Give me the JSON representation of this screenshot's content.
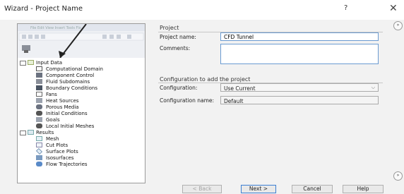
{
  "window": {
    "title": "Wizard - Project Name",
    "help_label": "?",
    "close_label": "✕"
  },
  "tree": {
    "input_data": {
      "label": "Input Data"
    },
    "input_items": [
      {
        "label": "Computational Domain",
        "icon": "domain-icon"
      },
      {
        "label": "Component Control",
        "icon": "component-icon"
      },
      {
        "label": "Fluid Subdomains",
        "icon": "fluid-icon"
      },
      {
        "label": "Boundary Conditions",
        "icon": "boundary-icon"
      },
      {
        "label": "Fans",
        "icon": "fan-icon"
      },
      {
        "label": "Heat Sources",
        "icon": "heat-icon"
      },
      {
        "label": "Porous Media",
        "icon": "porous-icon"
      },
      {
        "label": "Initial Conditions",
        "icon": "initial-icon"
      },
      {
        "label": "Goals",
        "icon": "goals-icon"
      },
      {
        "label": "Local Initial Meshes",
        "icon": "mesh-local-icon"
      }
    ],
    "results": {
      "label": "Results"
    },
    "result_items": [
      {
        "label": "Mesh",
        "icon": "mesh-icon"
      },
      {
        "label": "Cut Plots",
        "icon": "cut-plot-icon"
      },
      {
        "label": "Surface Plots",
        "icon": "surface-plot-icon"
      },
      {
        "label": "Isosurfaces",
        "icon": "isosurface-icon"
      },
      {
        "label": "Flow Trajectories",
        "icon": "trajectory-icon"
      }
    ]
  },
  "project": {
    "section_label": "Project",
    "name_label": "Project name:",
    "name_value": "CFD Tunnel",
    "comments_label": "Comments:",
    "comments_value": ""
  },
  "configuration": {
    "section_label": "Configuration to add the project",
    "config_label": "Configuration:",
    "config_value": "Use Current",
    "config_name_label": "Configuration name:",
    "config_name_value": "Default"
  },
  "buttons": {
    "back": "< Back",
    "next": "Next >",
    "cancel": "Cancel",
    "help": "Help"
  },
  "colors": {
    "accent": "#3c7fd3",
    "input_border": "#6b9bd1",
    "background": "#f2f2f2"
  }
}
